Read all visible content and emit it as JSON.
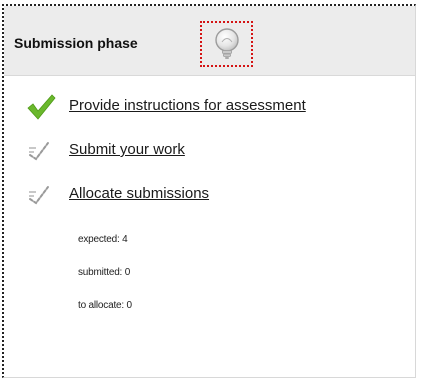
{
  "phase": {
    "title": "Submission phase",
    "info_icon": "lightbulb-icon"
  },
  "tasks": [
    {
      "label": "Provide instructions for assessment",
      "status": "done",
      "icon": "checkmark-icon"
    },
    {
      "label": "Submit your work",
      "status": "todo",
      "icon": "pending-check-icon"
    },
    {
      "label": "Allocate submissions",
      "status": "todo",
      "icon": "pending-check-icon"
    }
  ],
  "allocation": {
    "expected": "expected: 4",
    "submitted": "submitted: 0",
    "to_allocate": "to allocate: 0"
  },
  "colors": {
    "done": "#6ab82c",
    "pending": "#9a9a9a",
    "highlight_border": "#d41414"
  }
}
